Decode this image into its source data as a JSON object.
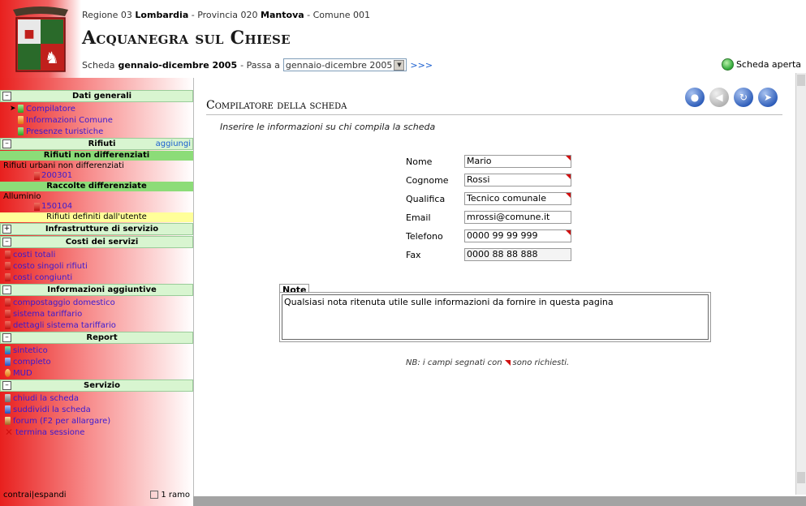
{
  "header": {
    "region_prefix": "Regione 03",
    "region": "Lombardia",
    "province_prefix": "- Provincia 020",
    "province": "Mantova",
    "comune": "- Comune 001",
    "title": "Acquanegra sul Chiese",
    "scheda_prefix": "Scheda",
    "scheda_period": "gennaio-dicembre 2005",
    "passa_label": "- Passa a",
    "period_select_value": "gennaio-dicembre 2005",
    "more_link": ">>>",
    "status": "Scheda aperta",
    "status_color": "#2fa838"
  },
  "sidebar": {
    "dati_generali": {
      "label": "Dati generali",
      "items": [
        "Compilatore",
        "Informazioni Comune",
        "Presenze turistiche"
      ]
    },
    "rifiuti": {
      "label": "Rifiuti",
      "add_label": "aggiungi",
      "non_diff_label": "Rifiuti non differenziati",
      "non_diff_item": "Rifiuti urbani non differenziati",
      "non_diff_code": "200301",
      "diff_label": "Raccolte differenziate",
      "diff_item": "Alluminio",
      "diff_code": "150104",
      "user_defined": "Rifiuti definiti dall'utente"
    },
    "infrastrutture": {
      "label": "Infrastrutture di servizio"
    },
    "costi": {
      "label": "Costi dei servizi",
      "items": [
        "costi totali",
        "costo singoli rifiuti",
        "costi congiunti"
      ]
    },
    "info_aggiuntive": {
      "label": "Informazioni aggiuntive",
      "items": [
        "compostaggio domestico",
        "sistema tariffario",
        "dettagli sistema tariffario"
      ]
    },
    "report": {
      "label": "Report",
      "items": [
        "sintetico",
        "completo",
        "MUD"
      ]
    },
    "servizio": {
      "label": "Servizio",
      "items": [
        "chiudi la scheda",
        "suddividi la scheda",
        "forum (F2 per allargare)",
        "termina sessione"
      ]
    },
    "footer": {
      "contrai": "contrai",
      "sep": "|",
      "espandi": "espandi",
      "ramo": "1 ramo"
    }
  },
  "main": {
    "section_title": "Compilatore della scheda",
    "intro": "Inserire le informazioni su chi compila la scheda",
    "fields": [
      {
        "label": "Nome",
        "value": "Mario",
        "required": true
      },
      {
        "label": "Cognome",
        "value": "Rossi",
        "required": true
      },
      {
        "label": "Qualifica",
        "value": "Tecnico comunale",
        "required": true
      },
      {
        "label": "Email",
        "value": "mrossi@comune.it",
        "required": false
      },
      {
        "label": "Telefono",
        "value": "0000 99 99 999",
        "required": true
      },
      {
        "label": "Fax",
        "value": "0000 88 88 888",
        "required": false
      }
    ],
    "note_tab": "Note",
    "note_text": "Qualsiasi nota ritenuta utile sulle informazioni da fornire in questa pagina",
    "nb_prefix": "NB: i campi segnati con",
    "nb_suffix": "sono richiesti.",
    "required_marker_color": "#d01010"
  }
}
